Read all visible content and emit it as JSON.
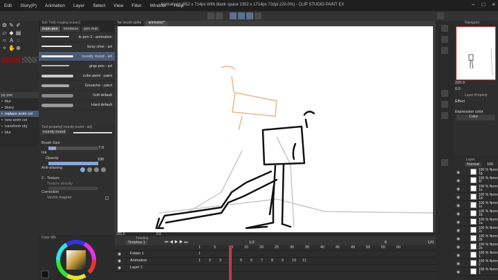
{
  "menu": {
    "items": [
      "Edit",
      "Story(P)",
      "Animation",
      "Layer",
      "Select",
      "View",
      "Filter",
      "Window",
      "Help"
    ],
    "title": "Animation* (852 x 714px With blank space 1352 x 1714px 72dpi 220.0%) - CLIP STUDIO PAINT EX"
  },
  "left_layers": [
    "blur",
    "bluey",
    "replace anim cel",
    "new anim cel",
    "transform obj",
    "blur"
  ],
  "left_layers_header": "py pse",
  "brush_tabs": [
    "main pen",
    "minimize",
    "pen mai"
  ],
  "brush_panel_title": "Sub Tool[ rouging eraser]",
  "brushes": [
    {
      "label": "le pen 3 - animation",
      "selected": false
    },
    {
      "label": "boxy cline - art",
      "selected": false
    },
    {
      "label": "roundy round - art",
      "selected": true
    },
    {
      "label": "grap pen - art",
      "selected": false
    },
    {
      "label": "cube paint - paint",
      "selected": false
    },
    {
      "label": "Gouache - paint",
      "selected": false
    },
    {
      "label": "Soft default",
      "selected": false
    },
    {
      "label": "Hard default",
      "selected": false
    }
  ],
  "tool_property": {
    "header": "Tool property[ roundy round - art]",
    "preset": "roundy round",
    "brush_size_label": "Brush Size",
    "brush_size_value": "7.0",
    "brush_size_fraction": 0.15,
    "ink_label": "Ink",
    "opacity_label": "Opacity",
    "opacity_value": "100",
    "opacity_fraction": 1.0,
    "antialiasing_label": "Anti-aliasing",
    "texture_label": "2 - Texture",
    "texture_density_label": "Texture density",
    "correction_label": "Correction",
    "vector_magnet_label": "Vector magnet"
  },
  "color_panel_title": "Color Wh",
  "canvas_tabs": [
    "fan brush sprite",
    "animation*"
  ],
  "canvas_zoom": "220.0",
  "canvas_rotation": "0.0",
  "timeline": {
    "title": "Timeline",
    "dropdown": "Timeline 1",
    "frame_ticks": [
      "1",
      "5",
      "10",
      "15",
      "20",
      "25",
      "30",
      "35",
      "40",
      "45",
      "49",
      "50",
      "55",
      "60"
    ],
    "playhead_top": "1/3",
    "current_frame": "8",
    "total_frames": "120",
    "rows": [
      {
        "name": "Folder 1",
        "frames": [
          "1"
        ]
      },
      {
        "name": "Animation",
        "frames": [
          "1",
          "2",
          "3",
          "4",
          "5",
          "6",
          "7",
          "8",
          "9",
          "10",
          "11"
        ]
      },
      {
        "name": "Layer 1",
        "frames": []
      }
    ]
  },
  "navigator": {
    "title": "Navigator",
    "zoom": "220.0",
    "rotation": "0.0"
  },
  "layer_property": {
    "title": "Layer Property",
    "effect_label": "Effect",
    "expression_label": "Expression color",
    "expression_value": "Color"
  },
  "layers_panel": {
    "title": "Layer",
    "blend_mode": "Normal",
    "opacity": "100",
    "rows": [
      {
        "line1": "100 % Norm",
        "line2": "1g"
      },
      {
        "line1": "100 % Norm",
        "line2": "1f"
      },
      {
        "line1": "100 % Norm",
        "line2": "1e"
      },
      {
        "line1": "100 % Norm",
        "line2": "1d"
      },
      {
        "line1": "100 % Norm",
        "line2": "1c"
      },
      {
        "line1": "100 % Norm",
        "line2": "1b"
      },
      {
        "line1": "100 % Norm",
        "line2": "1a"
      },
      {
        "line1": "100 % Norm",
        "line2": "2c"
      },
      {
        "line1": "100 % Norm",
        "line2": "2b"
      },
      {
        "line1": "100 % Norm",
        "line2": "2a"
      },
      {
        "line1": "100 % Norm",
        "line2": "1"
      },
      {
        "line1": "100 % Norm",
        "line2": "2"
      },
      {
        "line1": "100 % Norm",
        "line2": "1"
      }
    ]
  },
  "colors": {
    "accent": "#4a5a75",
    "playhead": "#c23b3b",
    "sketch_orange": "#e9b48a"
  }
}
